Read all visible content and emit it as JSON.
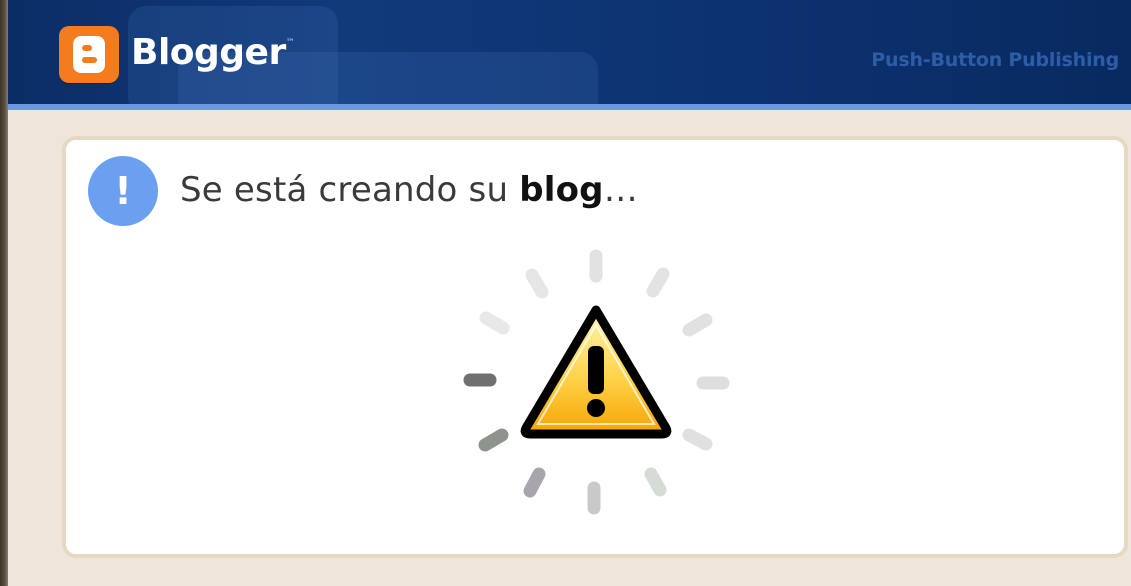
{
  "header": {
    "brand_name": "Blogger",
    "trademark": "™",
    "tagline": "Push-Button Publishing",
    "logo_icon": "blogger-logo-icon",
    "accent_color": "#f47c1e",
    "background_color": "#0b2d66"
  },
  "dialog": {
    "status_icon": "info-icon",
    "status_glyph": "!",
    "message_prefix": "Se está creando su ",
    "message_bold": "blog",
    "message_suffix": "…",
    "warning_icon": "warning-triangle-icon",
    "spinner_icon": "loading-spinner-icon"
  }
}
